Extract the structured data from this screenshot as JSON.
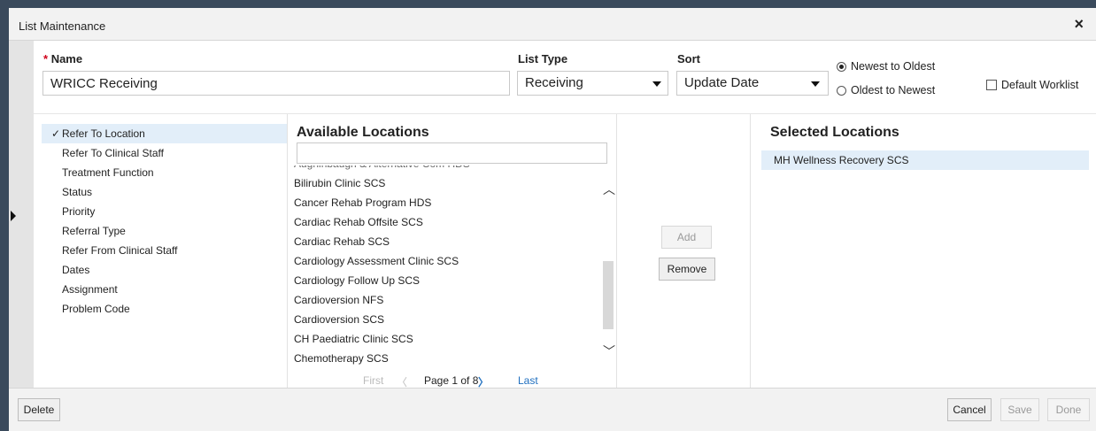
{
  "window": {
    "title": "List Maintenance",
    "close_label": "×"
  },
  "form": {
    "name_required_mark": "*",
    "name_label": "Name",
    "name_value": "WRICC Receiving",
    "list_type_label": "List Type",
    "list_type_value": "Receiving",
    "sort_label": "Sort",
    "sort_value": "Update Date",
    "sort_order_options": [
      {
        "label": "Newest to Oldest",
        "selected": true
      },
      {
        "label": "Oldest to Newest",
        "selected": false
      }
    ],
    "default_worklist_label": "Default Worklist",
    "default_worklist_checked": false
  },
  "filters": {
    "items": [
      {
        "label": "Refer To Location",
        "selected": true,
        "check": "✓"
      },
      {
        "label": "Refer To Clinical Staff",
        "selected": false
      },
      {
        "label": "Treatment Function",
        "selected": false
      },
      {
        "label": "Status",
        "selected": false
      },
      {
        "label": "Priority",
        "selected": false
      },
      {
        "label": "Referral Type",
        "selected": false
      },
      {
        "label": "Refer From Clinical Staff",
        "selected": false
      },
      {
        "label": "Dates",
        "selected": false
      },
      {
        "label": "Assignment",
        "selected": false
      },
      {
        "label": "Problem Code",
        "selected": false
      }
    ]
  },
  "available": {
    "heading": "Available Locations",
    "search_value": "",
    "items": [
      "Aughinbaugh & Alternative Com HDS",
      "Bilirubin Clinic SCS",
      "Cancer Rehab Program HDS",
      "Cardiac Rehab Offsite SCS",
      "Cardiac Rehab SCS",
      "Cardiology Assessment Clinic SCS",
      "Cardiology Follow Up SCS",
      "Cardioversion NFS",
      "Cardioversion SCS",
      "CH Paediatric Clinic SCS",
      "Chemotherapy SCS"
    ],
    "pager": {
      "first": "First",
      "prev": "〈",
      "page_text": "Page 1 of 8",
      "next": "〉",
      "last": "Last"
    }
  },
  "transfer": {
    "add_label": "Add",
    "remove_label": "Remove"
  },
  "selected": {
    "heading": "Selected Locations",
    "items": [
      "MH Wellness Recovery SCS"
    ]
  },
  "footer": {
    "delete_label": "Delete",
    "cancel_label": "Cancel",
    "save_label": "Save",
    "done_label": "Done"
  },
  "colors": {
    "accent": "#1f6fbf",
    "selection": "#e2eef9",
    "required": "#d0021b"
  }
}
